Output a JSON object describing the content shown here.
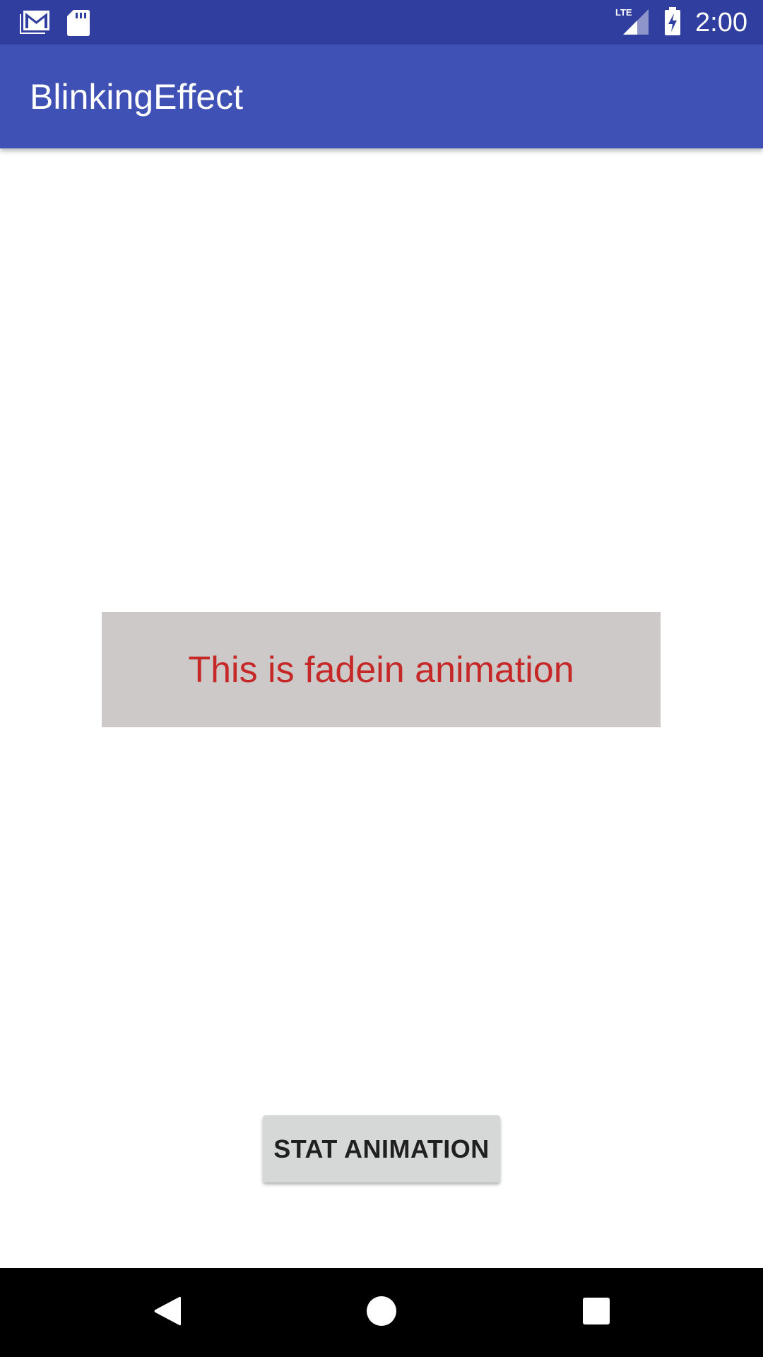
{
  "status_bar": {
    "background": "#303f9f",
    "left_icons": [
      "gmail-notification-icon",
      "sd-card-icon"
    ],
    "network_label": "LTE",
    "right_icons": [
      "lte-signal-icon",
      "battery-charging-icon"
    ],
    "time": "2:00"
  },
  "app_bar": {
    "title": "BlinkingEffect",
    "background": "#3f51b5"
  },
  "main": {
    "animated_text": "This is fadein animation",
    "animated_text_color": "#c62828",
    "animated_box_color": "#cdc9c9",
    "start_button_label": "STAT ANIMATION"
  },
  "nav_bar": {
    "buttons": [
      "back-icon",
      "home-icon",
      "recents-icon"
    ]
  }
}
